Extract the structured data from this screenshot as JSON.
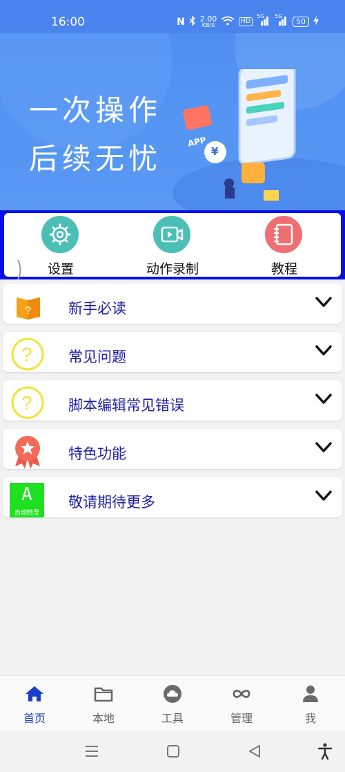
{
  "status_bar": {
    "time": "16:00",
    "nfc": "N",
    "speed_value": "2.00",
    "speed_unit": "KB/S",
    "hd": "HD",
    "sim1": "5G",
    "sim2": "5G",
    "battery": "50"
  },
  "banner": {
    "line1": "一次操作",
    "line2": "后续无忧",
    "app_badge": "APP",
    "yen": "¥"
  },
  "shortcuts": [
    {
      "label": "设置",
      "icon": "gear-icon",
      "color": "#4bbfb6"
    },
    {
      "label": "动作录制",
      "icon": "video-icon",
      "color": "#4bbfb6"
    },
    {
      "label": "教程",
      "icon": "notebook-icon",
      "color": "#ee6f72"
    }
  ],
  "list": [
    {
      "title": "新手必读",
      "icon": "book-question-icon"
    },
    {
      "title": "常见问题",
      "icon": "question-circle-icon"
    },
    {
      "title": "脚本编辑常见错误",
      "icon": "question-circle-icon"
    },
    {
      "title": "特色功能",
      "icon": "award-ribbon-icon"
    },
    {
      "title": "敬请期待更多",
      "icon": "app-logo-icon",
      "logo_letter": "A",
      "logo_caption": "自动精灵"
    }
  ],
  "tabs": [
    {
      "label": "首页",
      "icon": "home-icon",
      "active": true
    },
    {
      "label": "本地",
      "icon": "folder-icon",
      "active": false
    },
    {
      "label": "工具",
      "icon": "cloud-icon",
      "active": false
    },
    {
      "label": "管理",
      "icon": "infinity-icon",
      "active": false
    },
    {
      "label": "我",
      "icon": "person-icon",
      "active": false
    }
  ],
  "colors": {
    "accent": "#1a3ec9",
    "status_bar": "#4a84ee",
    "shortcut_frame": "#0a0ee6",
    "list_title": "#1d1da6"
  }
}
